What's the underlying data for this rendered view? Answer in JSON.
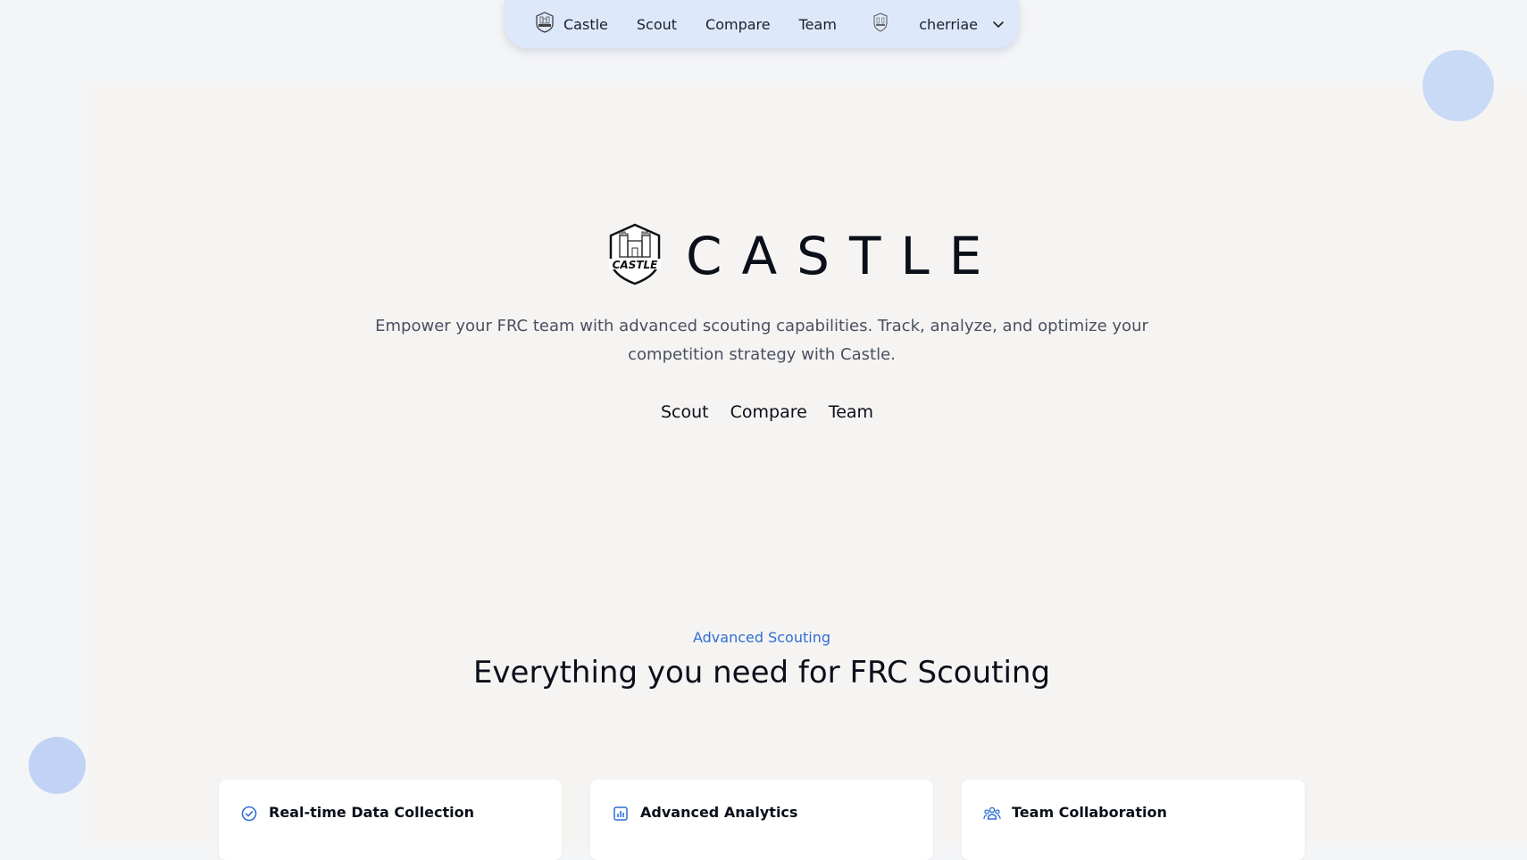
{
  "navbar": {
    "brand_label": "Castle",
    "links": [
      {
        "label": "Scout"
      },
      {
        "label": "Compare"
      },
      {
        "label": "Team"
      }
    ],
    "user": {
      "username": "cherriae"
    }
  },
  "hero": {
    "logo_text": "CASTLE",
    "title": "CASTLE",
    "description": "Empower your FRC team with advanced scouting capabilities. Track, analyze, and optimize your competition strategy with Castle.",
    "links": [
      {
        "label": "Scout"
      },
      {
        "label": "Compare"
      },
      {
        "label": "Team"
      }
    ]
  },
  "features": {
    "eyebrow": "Advanced Scouting",
    "title": "Everything you need for FRC Scouting",
    "cards": [
      {
        "title": "Real-time Data Collection",
        "icon": "check-circle-icon"
      },
      {
        "title": "Advanced Analytics",
        "icon": "bar-chart-icon"
      },
      {
        "title": "Team Collaboration",
        "icon": "users-icon"
      }
    ]
  },
  "colors": {
    "accent": "#2f6ed6",
    "navbar_bg": "#dde8fb",
    "blob": "#c9daf6"
  }
}
